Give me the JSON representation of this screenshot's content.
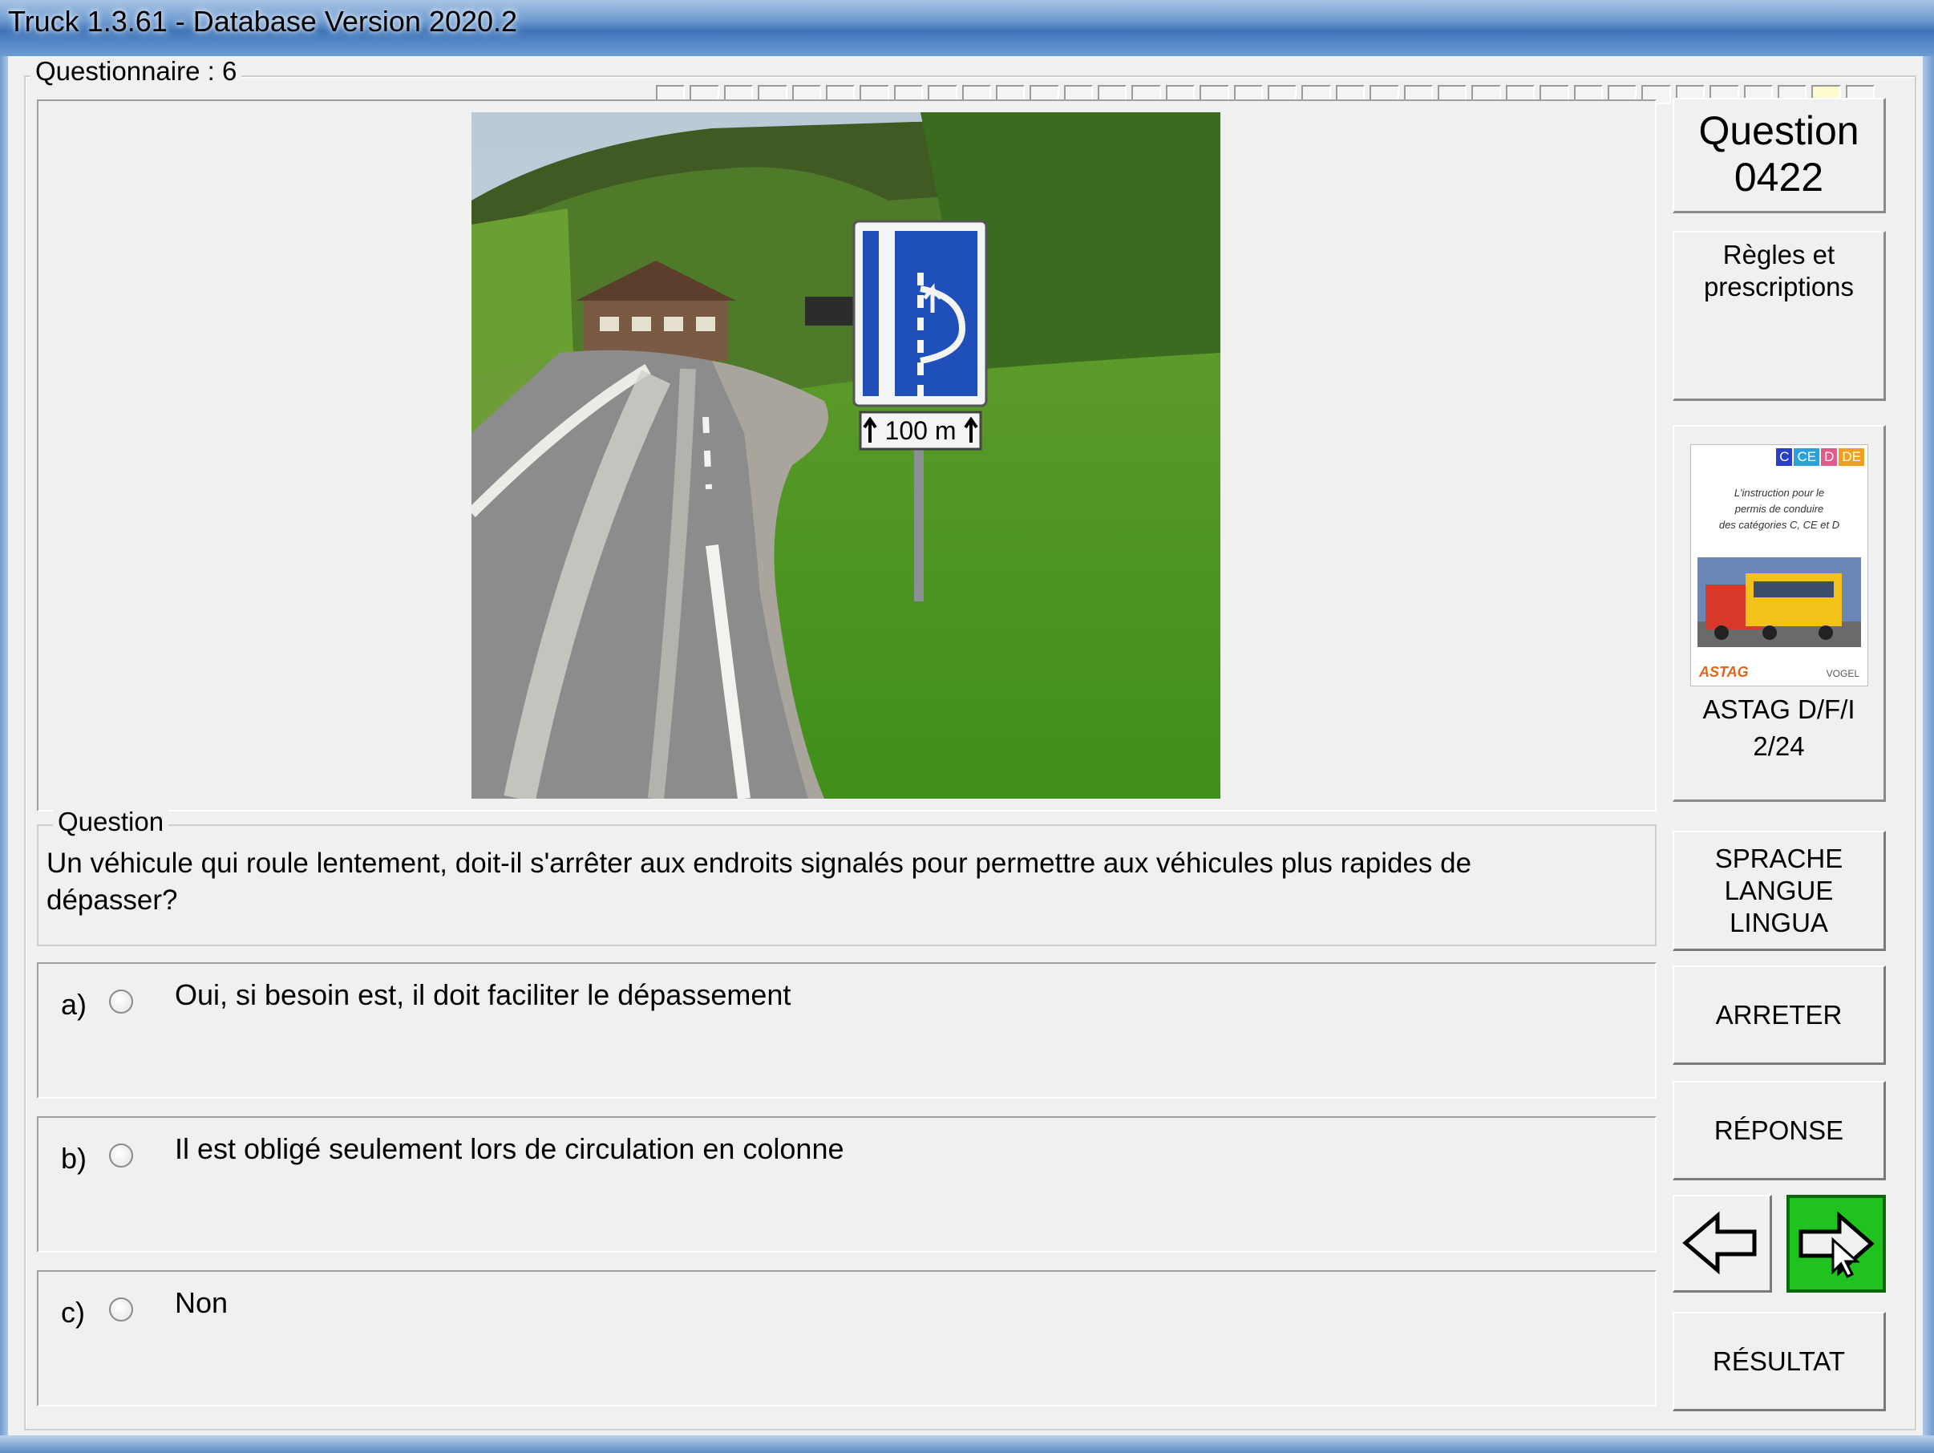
{
  "window": {
    "title": "Truck 1.3.61 - Database Version 2020.2"
  },
  "questionnaire": {
    "label": "Questionnaire : 6",
    "progress_total": 36,
    "progress_current": 35
  },
  "question_panel": {
    "number_label": "Question",
    "number": "0422",
    "category": "Règles et prescriptions",
    "book_caption_line1": "ASTAG D/F/I",
    "book_caption_line2": "2/24",
    "book_cover": {
      "badges": [
        "C",
        "CE",
        "D",
        "DE"
      ],
      "text_lines": [
        "L'instruction pour le",
        "permis de conduire",
        "des catégories C, CE et D"
      ],
      "logo_left": "ASTAG",
      "logo_right": "VOGEL"
    }
  },
  "question": {
    "label": "Question",
    "text": "Un véhicule qui roule lentement, doit-il s'arrêter aux endroits signalés pour permettre aux véhicules plus rapides de dépasser?"
  },
  "answers": [
    {
      "letter": "a)",
      "text": "Oui, si besoin est, il doit faciliter le dépassement",
      "selected": false
    },
    {
      "letter": "b)",
      "text": "Il est obligé seulement lors de circulation en colonne",
      "selected": false
    },
    {
      "letter": "c)",
      "text": "Non",
      "selected": false
    }
  ],
  "image": {
    "sign_distance": "100 m"
  },
  "buttons": {
    "language": "SPRACHE\nLANGUE\nLINGUA",
    "language_line1": "SPRACHE",
    "language_line2": "LANGUE",
    "language_line3": "LINGUA",
    "stop": "ARRETER",
    "answer": "RÉPONSE",
    "result": "RÉSULTAT",
    "prev_icon": "arrow-left-icon",
    "next_icon": "arrow-right-icon"
  },
  "colors": {
    "next_button": "#1fc21f",
    "sign_blue": "#1f4fb8"
  }
}
